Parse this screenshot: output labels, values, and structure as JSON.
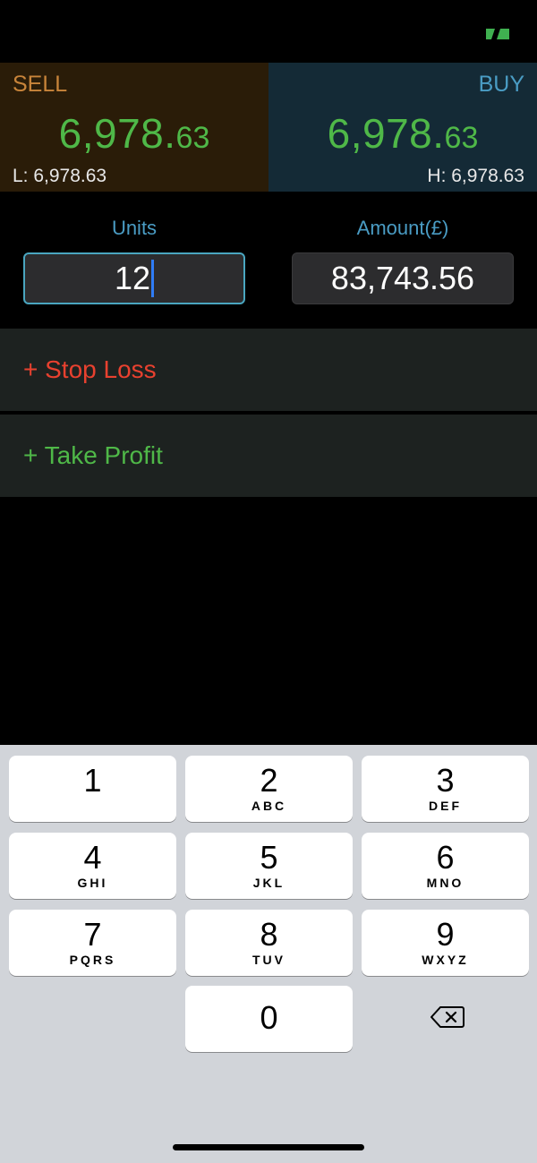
{
  "header": {
    "icon": "switch-arrows-icon",
    "accent": "#3fb050"
  },
  "sell": {
    "label": "SELL",
    "price_main": "6,978.",
    "price_frac": "63",
    "low": "L: 6,978.63"
  },
  "buy": {
    "label": "BUY",
    "price_main": "6,978.",
    "price_frac": "63",
    "high": "H: 6,978.63"
  },
  "order": {
    "units_label": "Units",
    "units_value": "12",
    "amount_label": "Amount(£)",
    "amount_value": "83,743.56"
  },
  "options": {
    "stop_loss": "+ Stop Loss",
    "take_profit": "+ Take Profit"
  },
  "colors": {
    "sell_bg": "#2a1c08",
    "buy_bg": "#142a36",
    "price": "#4fb848",
    "stop_loss": "#e8412f",
    "take_profit": "#4fb848"
  },
  "keypad": {
    "keys": [
      {
        "digit": "1",
        "letters": ""
      },
      {
        "digit": "2",
        "letters": "ABC"
      },
      {
        "digit": "3",
        "letters": "DEF"
      },
      {
        "digit": "4",
        "letters": "GHI"
      },
      {
        "digit": "5",
        "letters": "JKL"
      },
      {
        "digit": "6",
        "letters": "MNO"
      },
      {
        "digit": "7",
        "letters": "PQRS"
      },
      {
        "digit": "8",
        "letters": "TUV"
      },
      {
        "digit": "9",
        "letters": "WXYZ"
      },
      {
        "digit": "0",
        "letters": ""
      }
    ],
    "delete_icon": "backspace-icon"
  }
}
